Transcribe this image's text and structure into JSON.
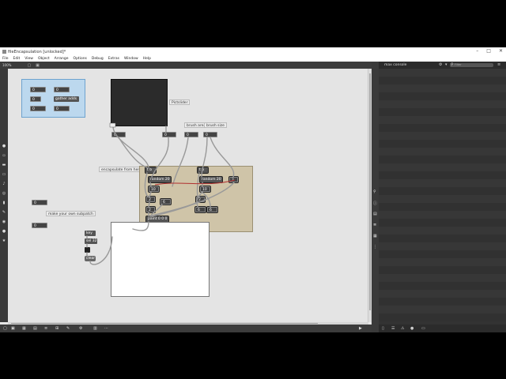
{
  "window": {
    "title": "fileEncapsulation [unlocked]*",
    "buttons": [
      "–",
      "□",
      "✕"
    ]
  },
  "menu": [
    "File",
    "Edit",
    "View",
    "Object",
    "Arrange",
    "Options",
    "Debug",
    "Extras",
    "Window",
    "Help"
  ],
  "toolbar": {
    "zoom": "100%"
  },
  "console": {
    "title": "max console",
    "search_placeholder": "Filter"
  },
  "patch": {
    "bpatcher_numbers": [
      "0",
      "0",
      "0",
      "0",
      "0"
    ],
    "bpatcher_label": "gather adds",
    "pictslider_label": "Pictslider",
    "pictslider_outs": [
      "0",
      "0",
      "0",
      "0"
    ],
    "brush_area": "brush area",
    "brush_size": "brush size",
    "encapsulate_comment": "encapsulate from here",
    "make_subpatch_comment": "make your own subpatch",
    "left_numbers": [
      "0",
      "0"
    ],
    "encap_objects": {
      "t1": "t b",
      "t2": "t b",
      "random1": "random 20",
      "random2": "random 20",
      "num_a": "10",
      "num_b": "10",
      "num_c": "2",
      "num_d": "6",
      "num_e": "2",
      "num_f": "6",
      "num_g": "2",
      "num_h": "6",
      "num_i": "2",
      "paint": "paint 0 0 0 0"
    },
    "key_obj": "key",
    "sel_obj": "sel 32",
    "clear_msg": "clear"
  }
}
